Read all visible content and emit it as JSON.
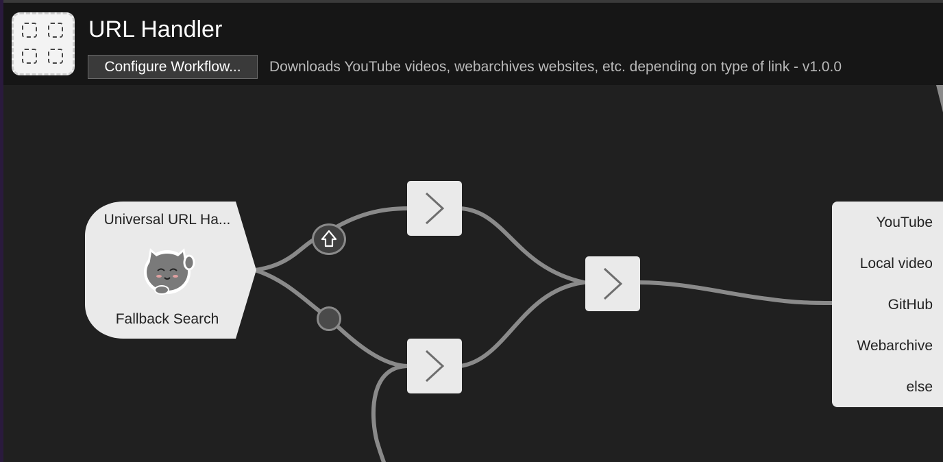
{
  "header": {
    "title": "URL Handler",
    "configure_button": "Configure Workflow...",
    "description": "Downloads YouTube videos, webarchives websites, etc. depending on type of link - v1.0.0"
  },
  "trigger": {
    "title": "Universal URL Ha...",
    "subtitle": "Fallback Search",
    "icon": "cat-waving-icon"
  },
  "filters": [
    {
      "icon": "shift-key-icon"
    },
    {
      "icon": "no-modifier-icon"
    }
  ],
  "outputs": [
    "YouTube",
    "Local video",
    "GitHub",
    "Webarchive",
    "else"
  ],
  "colors": {
    "background": "#202020",
    "header_bg": "#161616",
    "node_bg": "#eaeaea",
    "connector": "#8a8a8a",
    "text_primary": "#ffffff",
    "text_secondary": "#b9b9b9"
  }
}
